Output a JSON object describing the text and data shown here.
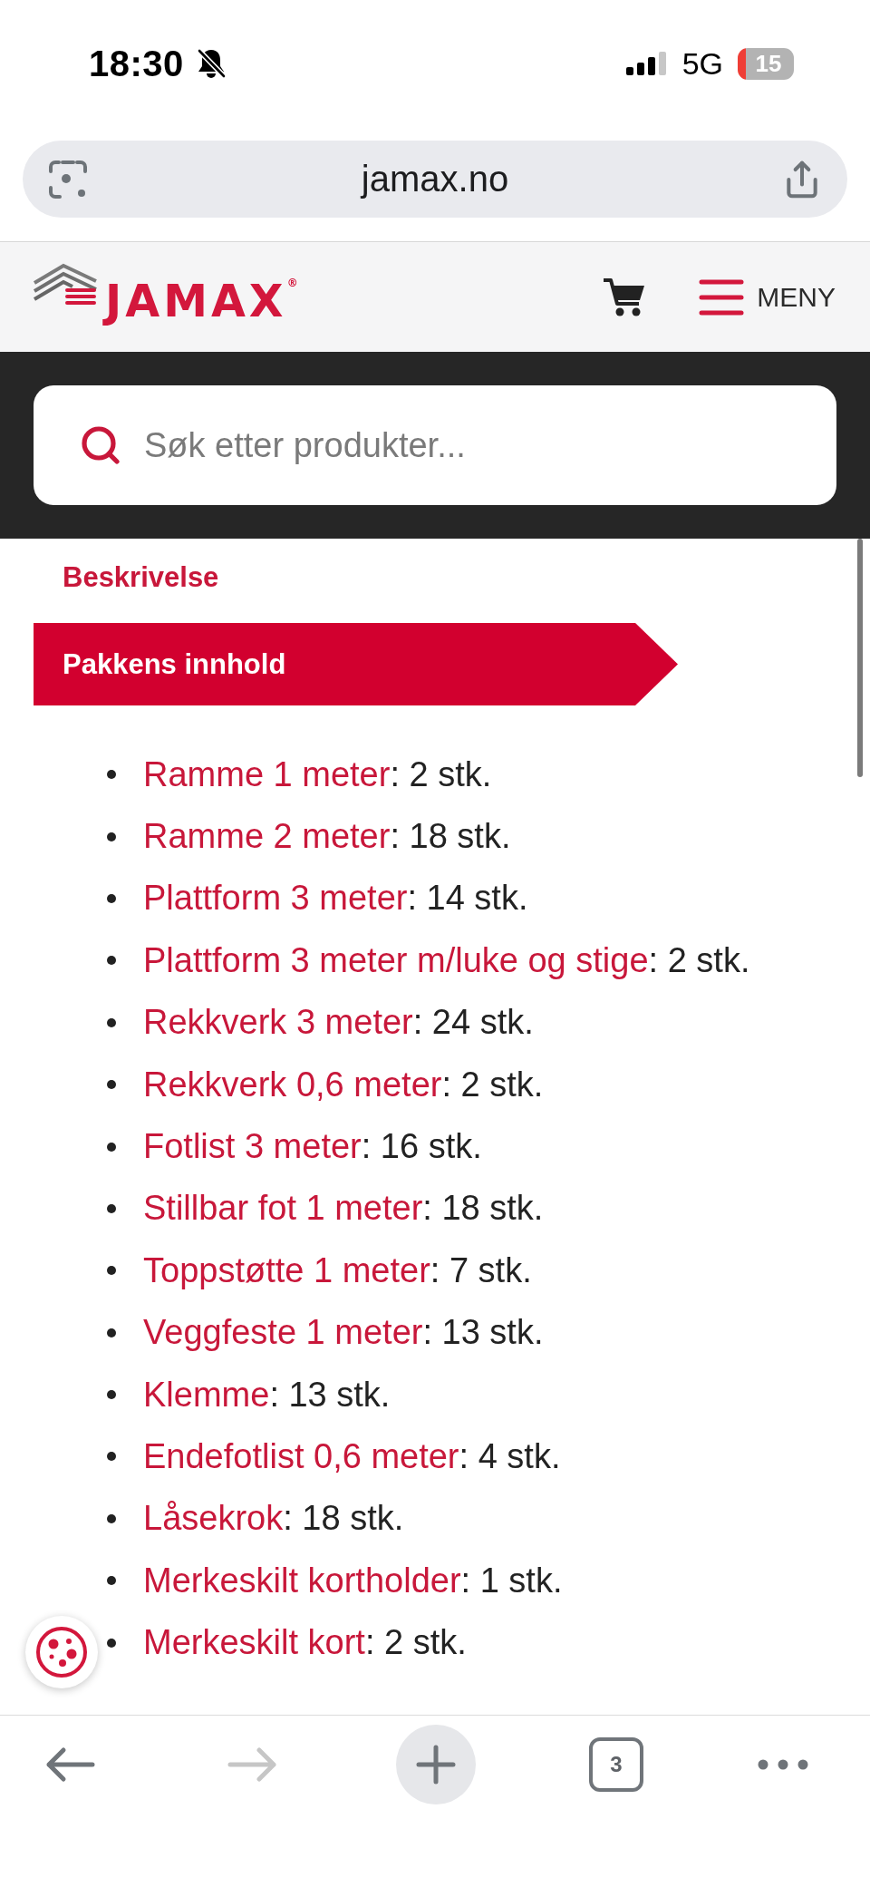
{
  "status_bar": {
    "time": "18:30",
    "network": "5G",
    "battery": "15"
  },
  "address_bar": {
    "url": "jamax.no"
  },
  "header": {
    "logo": "JAMAX$^{®}$",
    "menu_label": "MENY"
  },
  "search": {
    "placeholder": "Søk etter produkter..."
  },
  "tabs": [
    {
      "label": "Beskrivelse",
      "selected": false
    },
    {
      "label": "Pakkens innhold",
      "selected": true
    }
  ],
  "package_contents": [
    {
      "name": "Ramme 1 meter",
      "suffix": ": 2 stk."
    },
    {
      "name": "Ramme 2 meter",
      "suffix": ": 18 stk."
    },
    {
      "name": "Plattform 3 meter",
      "suffix": ": 14 stk."
    },
    {
      "name": "Plattform 3 meter m/luke og stige",
      "suffix": ": 2 stk."
    },
    {
      "name": "Rekkverk 3 meter",
      "suffix": ": 24 stk."
    },
    {
      "name": "Rekkverk 0,6 meter",
      "suffix": ": 2 stk."
    },
    {
      "name": "Fotlist 3 meter",
      "suffix": ": 16 stk."
    },
    {
      "name": "Stillbar fot 1 meter",
      "suffix": ": 18 stk."
    },
    {
      "name": "Toppstøtte 1 meter",
      "suffix": ": 7 stk."
    },
    {
      "name": "Veggfeste 1 meter",
      "suffix": ": 13 stk."
    },
    {
      "name": "Klemme",
      "suffix": ": 13 stk."
    },
    {
      "name": "Endefotlist 0,6 meter",
      "suffix": ": 4 stk."
    },
    {
      "name": "Låsekrok",
      "suffix": ": 18 stk."
    },
    {
      "name": "Merkeskilt kortholder",
      "suffix": ": 1 stk."
    },
    {
      "name": "Merkeskilt kort",
      "suffix": ": 2 stk."
    }
  ],
  "browser_toolbar": {
    "back_disabled": false,
    "forward_disabled": true,
    "tab_count": "3"
  }
}
